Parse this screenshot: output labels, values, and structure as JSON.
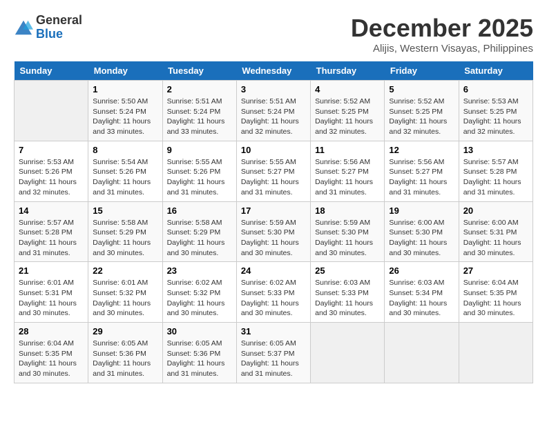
{
  "header": {
    "logo_general": "General",
    "logo_blue": "Blue",
    "month_year": "December 2025",
    "location": "Alijis, Western Visayas, Philippines"
  },
  "calendar": {
    "days_of_week": [
      "Sunday",
      "Monday",
      "Tuesday",
      "Wednesday",
      "Thursday",
      "Friday",
      "Saturday"
    ],
    "weeks": [
      [
        {
          "day": "",
          "info": ""
        },
        {
          "day": "1",
          "info": "Sunrise: 5:50 AM\nSunset: 5:24 PM\nDaylight: 11 hours\nand 33 minutes."
        },
        {
          "day": "2",
          "info": "Sunrise: 5:51 AM\nSunset: 5:24 PM\nDaylight: 11 hours\nand 33 minutes."
        },
        {
          "day": "3",
          "info": "Sunrise: 5:51 AM\nSunset: 5:24 PM\nDaylight: 11 hours\nand 32 minutes."
        },
        {
          "day": "4",
          "info": "Sunrise: 5:52 AM\nSunset: 5:25 PM\nDaylight: 11 hours\nand 32 minutes."
        },
        {
          "day": "5",
          "info": "Sunrise: 5:52 AM\nSunset: 5:25 PM\nDaylight: 11 hours\nand 32 minutes."
        },
        {
          "day": "6",
          "info": "Sunrise: 5:53 AM\nSunset: 5:25 PM\nDaylight: 11 hours\nand 32 minutes."
        }
      ],
      [
        {
          "day": "7",
          "info": "Sunrise: 5:53 AM\nSunset: 5:26 PM\nDaylight: 11 hours\nand 32 minutes."
        },
        {
          "day": "8",
          "info": "Sunrise: 5:54 AM\nSunset: 5:26 PM\nDaylight: 11 hours\nand 31 minutes."
        },
        {
          "day": "9",
          "info": "Sunrise: 5:55 AM\nSunset: 5:26 PM\nDaylight: 11 hours\nand 31 minutes."
        },
        {
          "day": "10",
          "info": "Sunrise: 5:55 AM\nSunset: 5:27 PM\nDaylight: 11 hours\nand 31 minutes."
        },
        {
          "day": "11",
          "info": "Sunrise: 5:56 AM\nSunset: 5:27 PM\nDaylight: 11 hours\nand 31 minutes."
        },
        {
          "day": "12",
          "info": "Sunrise: 5:56 AM\nSunset: 5:27 PM\nDaylight: 11 hours\nand 31 minutes."
        },
        {
          "day": "13",
          "info": "Sunrise: 5:57 AM\nSunset: 5:28 PM\nDaylight: 11 hours\nand 31 minutes."
        }
      ],
      [
        {
          "day": "14",
          "info": "Sunrise: 5:57 AM\nSunset: 5:28 PM\nDaylight: 11 hours\nand 31 minutes."
        },
        {
          "day": "15",
          "info": "Sunrise: 5:58 AM\nSunset: 5:29 PM\nDaylight: 11 hours\nand 30 minutes."
        },
        {
          "day": "16",
          "info": "Sunrise: 5:58 AM\nSunset: 5:29 PM\nDaylight: 11 hours\nand 30 minutes."
        },
        {
          "day": "17",
          "info": "Sunrise: 5:59 AM\nSunset: 5:30 PM\nDaylight: 11 hours\nand 30 minutes."
        },
        {
          "day": "18",
          "info": "Sunrise: 5:59 AM\nSunset: 5:30 PM\nDaylight: 11 hours\nand 30 minutes."
        },
        {
          "day": "19",
          "info": "Sunrise: 6:00 AM\nSunset: 5:30 PM\nDaylight: 11 hours\nand 30 minutes."
        },
        {
          "day": "20",
          "info": "Sunrise: 6:00 AM\nSunset: 5:31 PM\nDaylight: 11 hours\nand 30 minutes."
        }
      ],
      [
        {
          "day": "21",
          "info": "Sunrise: 6:01 AM\nSunset: 5:31 PM\nDaylight: 11 hours\nand 30 minutes."
        },
        {
          "day": "22",
          "info": "Sunrise: 6:01 AM\nSunset: 5:32 PM\nDaylight: 11 hours\nand 30 minutes."
        },
        {
          "day": "23",
          "info": "Sunrise: 6:02 AM\nSunset: 5:32 PM\nDaylight: 11 hours\nand 30 minutes."
        },
        {
          "day": "24",
          "info": "Sunrise: 6:02 AM\nSunset: 5:33 PM\nDaylight: 11 hours\nand 30 minutes."
        },
        {
          "day": "25",
          "info": "Sunrise: 6:03 AM\nSunset: 5:33 PM\nDaylight: 11 hours\nand 30 minutes."
        },
        {
          "day": "26",
          "info": "Sunrise: 6:03 AM\nSunset: 5:34 PM\nDaylight: 11 hours\nand 30 minutes."
        },
        {
          "day": "27",
          "info": "Sunrise: 6:04 AM\nSunset: 5:35 PM\nDaylight: 11 hours\nand 30 minutes."
        }
      ],
      [
        {
          "day": "28",
          "info": "Sunrise: 6:04 AM\nSunset: 5:35 PM\nDaylight: 11 hours\nand 30 minutes."
        },
        {
          "day": "29",
          "info": "Sunrise: 6:05 AM\nSunset: 5:36 PM\nDaylight: 11 hours\nand 31 minutes."
        },
        {
          "day": "30",
          "info": "Sunrise: 6:05 AM\nSunset: 5:36 PM\nDaylight: 11 hours\nand 31 minutes."
        },
        {
          "day": "31",
          "info": "Sunrise: 6:05 AM\nSunset: 5:37 PM\nDaylight: 11 hours\nand 31 minutes."
        },
        {
          "day": "",
          "info": ""
        },
        {
          "day": "",
          "info": ""
        },
        {
          "day": "",
          "info": ""
        }
      ]
    ]
  }
}
